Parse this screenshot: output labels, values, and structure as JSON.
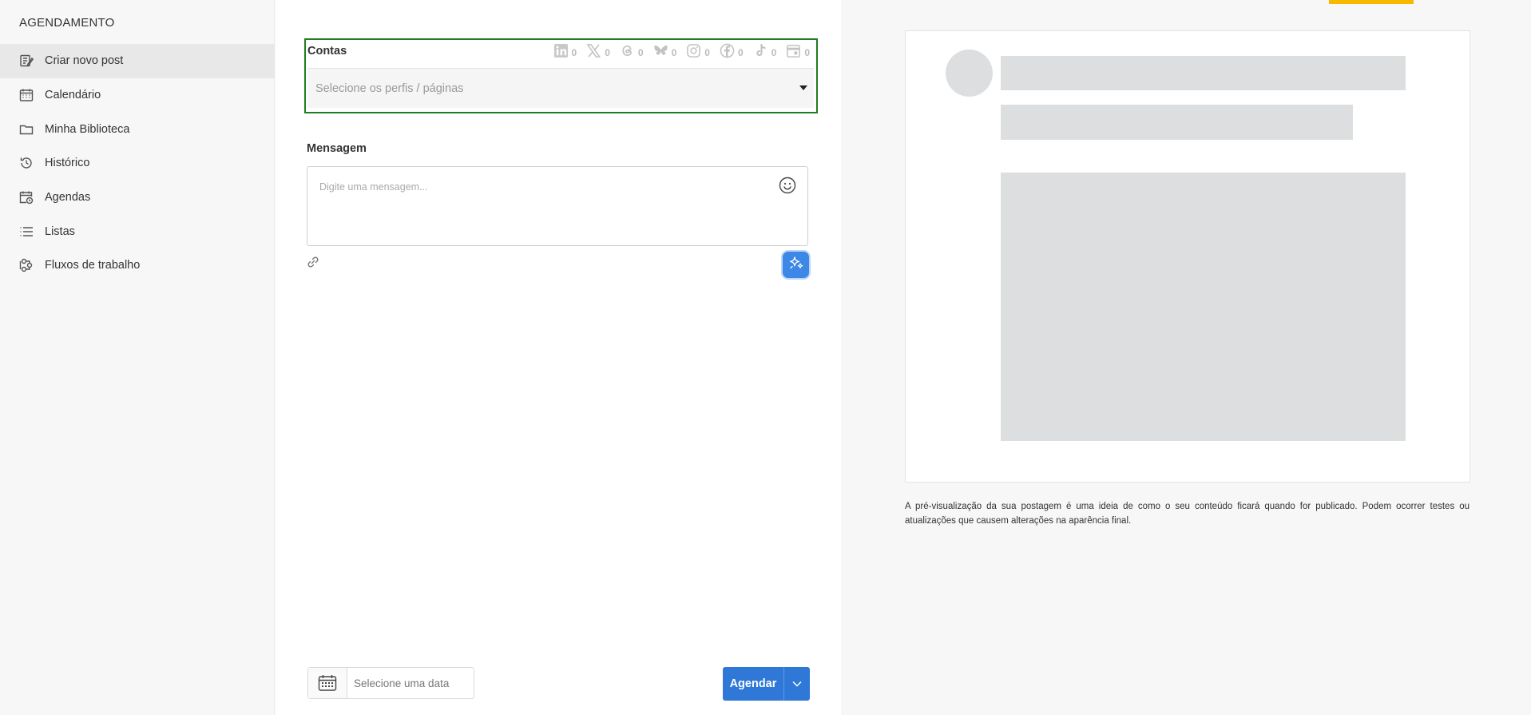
{
  "sidebar": {
    "title": "AGENDAMENTO",
    "items": [
      {
        "label": "Criar novo post",
        "icon": "edit-post-icon",
        "active": true
      },
      {
        "label": "Calendário",
        "icon": "calendar-icon",
        "active": false
      },
      {
        "label": "Minha Biblioteca",
        "icon": "folder-icon",
        "active": false
      },
      {
        "label": "Histórico",
        "icon": "history-icon",
        "active": false
      },
      {
        "label": "Agendas",
        "icon": "calendar-clock-icon",
        "active": false
      },
      {
        "label": "Listas",
        "icon": "list-icon",
        "active": false
      },
      {
        "label": "Fluxos de trabalho",
        "icon": "workflow-icon",
        "active": false
      }
    ]
  },
  "accounts": {
    "label": "Contas",
    "placeholder": "Selecione os perfis / páginas",
    "networks": [
      {
        "name": "linkedin",
        "icon": "linkedin-icon",
        "count": "0"
      },
      {
        "name": "x",
        "icon": "x-icon",
        "count": "0"
      },
      {
        "name": "threads",
        "icon": "threads-icon",
        "count": "0"
      },
      {
        "name": "bluesky",
        "icon": "bluesky-icon",
        "count": "0"
      },
      {
        "name": "instagram",
        "icon": "instagram-icon",
        "count": "0"
      },
      {
        "name": "facebook",
        "icon": "facebook-icon",
        "count": "0"
      },
      {
        "name": "tiktok",
        "icon": "tiktok-icon",
        "count": "0"
      },
      {
        "name": "google-business",
        "icon": "store-icon",
        "count": "0"
      }
    ]
  },
  "message": {
    "label": "Mensagem",
    "placeholder": "Digite uma mensagem..."
  },
  "footer": {
    "date_placeholder": "Selecione uma data",
    "schedule_label": "Agendar"
  },
  "preview": {
    "note": "A pré-visualização da sua postagem é uma ideia de como o seu conteúdo ficará quando for publicado. Podem ocorrer testes ou atualizações que causem alterações na aparência final."
  },
  "colors": {
    "accent_blue": "#2f78d8",
    "highlight_green": "#1f7d1f",
    "top_accent_yellow": "#f6b900",
    "skeleton_gray": "#dcdedf"
  }
}
